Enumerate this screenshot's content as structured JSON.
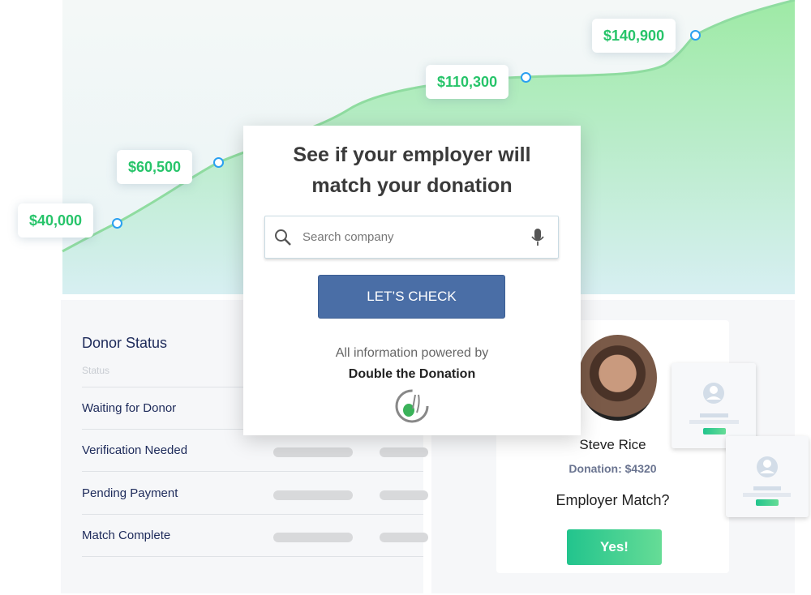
{
  "growth_labels": [
    {
      "value": "$40,000"
    },
    {
      "value": "$60,500"
    },
    {
      "value": "$110,300"
    },
    {
      "value": "$140,900"
    }
  ],
  "colors": {
    "accent_green": "#27c46a",
    "button_blue": "#4a6ea6",
    "dot_blue": "#2aa0f0"
  },
  "donor_status": {
    "title": "Donor Status",
    "column_header": "Status",
    "rows": [
      "Waiting for Donor",
      "Verification Needed",
      "Pending Payment",
      "Match Complete"
    ]
  },
  "modal": {
    "title_line1": "See if your employer will",
    "title_line2": "match your donation",
    "search_placeholder": "Search company",
    "search_value": "",
    "check_button": "LET’S CHECK",
    "powered_by": "All information powered by",
    "brand": "Double the Donation"
  },
  "profile": {
    "name": "Steve Rice",
    "donation": "Donation: $4320",
    "question": "Employer Match?",
    "yes_button": "Yes!"
  }
}
